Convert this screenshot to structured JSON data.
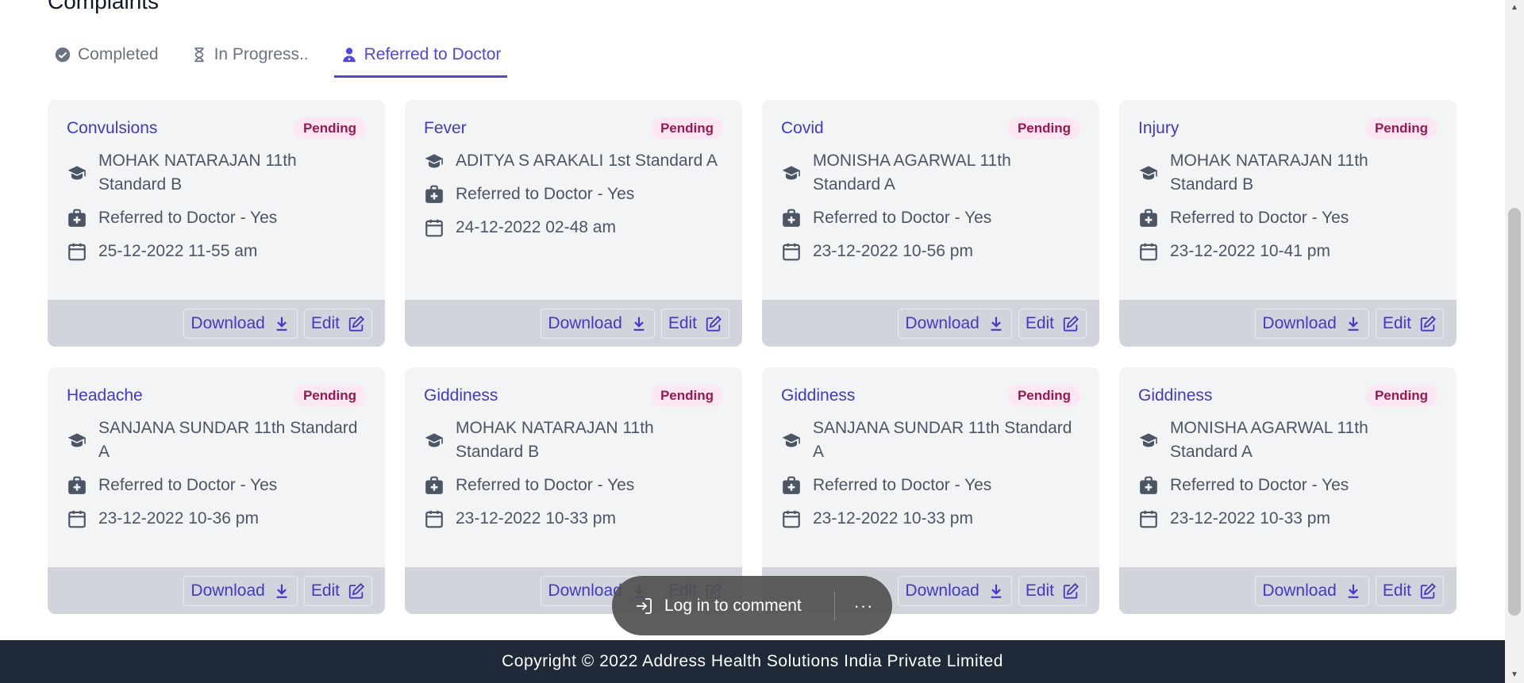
{
  "page": {
    "heading": "Complaints"
  },
  "tabs": [
    {
      "label": "Completed",
      "icon": "check-circle-icon",
      "active": false
    },
    {
      "label": "In Progress..",
      "icon": "hourglass-icon",
      "active": false
    },
    {
      "label": "Referred to Doctor",
      "icon": "doctor-icon",
      "active": true
    }
  ],
  "cards": [
    {
      "title": "Convulsions",
      "status": "Pending",
      "student": "MOHAK NATARAJAN 11th Standard B",
      "referred": "Referred to Doctor - Yes",
      "datetime": "25-12-2022 11-55 am",
      "download_label": "Download",
      "edit_label": "Edit"
    },
    {
      "title": "Fever",
      "status": "Pending",
      "student": "ADITYA S ARAKALI 1st Standard A",
      "referred": "Referred to Doctor - Yes",
      "datetime": "24-12-2022 02-48 am",
      "download_label": "Download",
      "edit_label": "Edit"
    },
    {
      "title": "Covid",
      "status": "Pending",
      "student": "MONISHA AGARWAL 11th Standard A",
      "referred": "Referred to Doctor - Yes",
      "datetime": "23-12-2022 10-56 pm",
      "download_label": "Download",
      "edit_label": "Edit"
    },
    {
      "title": "Injury",
      "status": "Pending",
      "student": "MOHAK NATARAJAN 11th Standard B",
      "referred": "Referred to Doctor - Yes",
      "datetime": "23-12-2022 10-41 pm",
      "download_label": "Download",
      "edit_label": "Edit"
    },
    {
      "title": "Headache",
      "status": "Pending",
      "student": "SANJANA SUNDAR 11th Standard A",
      "referred": "Referred to Doctor - Yes",
      "datetime": "23-12-2022 10-36 pm",
      "download_label": "Download",
      "edit_label": "Edit"
    },
    {
      "title": "Giddiness",
      "status": "Pending",
      "student": "MOHAK NATARAJAN 11th Standard B",
      "referred": "Referred to Doctor - Yes",
      "datetime": "23-12-2022 10-33 pm",
      "download_label": "Download",
      "edit_label": "Edit"
    },
    {
      "title": "Giddiness",
      "status": "Pending",
      "student": "SANJANA SUNDAR 11th Standard A",
      "referred": "Referred to Doctor - Yes",
      "datetime": "23-12-2022 10-33 pm",
      "download_label": "Download",
      "edit_label": "Edit"
    },
    {
      "title": "Giddiness",
      "status": "Pending",
      "student": "MONISHA AGARWAL 11th Standard A",
      "referred": "Referred to Doctor - Yes",
      "datetime": "23-12-2022 10-33 pm",
      "download_label": "Download",
      "edit_label": "Edit"
    }
  ],
  "comment_bar": {
    "label": "Log in to comment",
    "more": "···"
  },
  "footer": {
    "copyright": "Copyright © 2022 Address Health Solutions India Private Limited"
  },
  "colors": {
    "accent": "#4f46e5",
    "badge_bg": "#fce7f3",
    "badge_text": "#9d174d",
    "card_bg": "#f3f4f6",
    "card_footer_bg": "#d1d5db",
    "footer_bg": "#1f2937"
  }
}
